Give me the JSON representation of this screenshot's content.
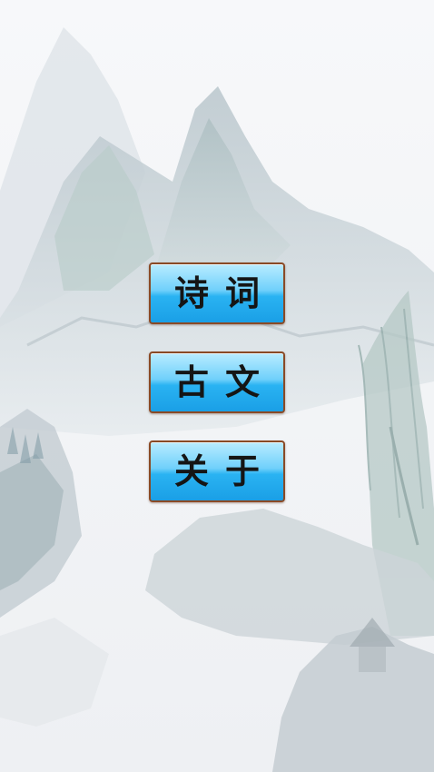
{
  "screen": {
    "background": "ink-wash-landscape",
    "accent_color": "#2ab3f2",
    "border_color": "#8a4a26"
  },
  "menu": {
    "poetry_label": "诗词",
    "prose_label": "古文",
    "about_label": "关于"
  }
}
